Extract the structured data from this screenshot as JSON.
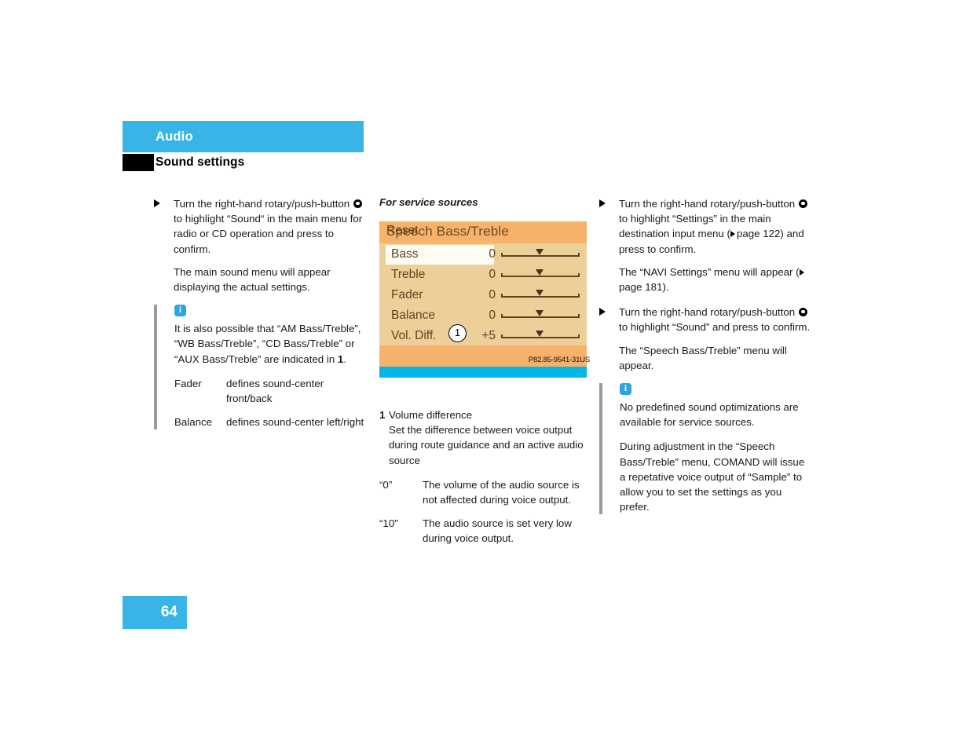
{
  "header": {
    "chapter": "Audio",
    "section": "Sound settings",
    "accent_color": "#38b5e6",
    "marker_color": "#000000"
  },
  "column_1": {
    "step_1": {
      "line_a": "Turn the right-hand rotary/push-button",
      "line_b": "to highlight “Sound“ in the main menu for radio or CD operation and press to confirm.",
      "result": "The main sound menu will appear displaying the actual settings."
    },
    "note": {
      "icon": "info-icon",
      "text_parts": {
        "before": "It is also possible that “AM Bass/Treble”, “WB Bass/Treble”, “CD Bass/Treble” or “AUX Bass/Treble” are indicated in ",
        "callout": "1",
        "after": "."
      },
      "definitions": [
        {
          "term": "Fader",
          "desc": "defines sound-center front/back"
        },
        {
          "term": "Balance",
          "desc": "defines sound-center left/right"
        }
      ]
    }
  },
  "column_2": {
    "figure_heading": "For service sources",
    "comand_screen": {
      "title": "Speech Bass/Treble",
      "rows": [
        {
          "label": "Bass",
          "value": "0",
          "highlighted": true
        },
        {
          "label": "Treble",
          "value": "0",
          "highlighted": false
        },
        {
          "label": "Fader",
          "value": "0",
          "highlighted": false
        },
        {
          "label": "Balance",
          "value": "0",
          "highlighted": false
        },
        {
          "label": "Vol. Diff.",
          "value": "+5",
          "highlighted": false
        }
      ],
      "reset_label": "Reset",
      "callout_label": "1",
      "colors": {
        "title_bar": "#f6b26b",
        "body": "#edcf9a",
        "highlight": "#fdfbf4",
        "text": "#5f4420",
        "bottom_bar": "#00b7e8"
      }
    },
    "figure_code": "P82.85-9541-31US",
    "caption": {
      "number": "1",
      "title": "Volume difference",
      "description": "Set the difference between voice output during route guidance and an active audio source",
      "values": [
        {
          "term": "“0”",
          "desc": "The volume of the audio source is not affected during voice output."
        },
        {
          "term": "“10”",
          "desc": "The audio source is set very low during voice output."
        }
      ]
    }
  },
  "column_3": {
    "step_1": {
      "line_a": "Turn the right-hand rotary/push-button",
      "line_b_pre": "to highlight “Settings” in the main destination input menu (",
      "page_ref_1": "page 122",
      "line_b_post": ") and press to confirm.",
      "result_pre": "The “NAVI Settings” menu will appear (",
      "page_ref_2": "page 181",
      "result_post": ")."
    },
    "step_2": {
      "line_a": "Turn the right-hand rotary/push-button",
      "line_b": "to highlight “Sound” and press to confirm.",
      "result": "The “Speech Bass/Treble” menu will appear."
    },
    "note": {
      "icon": "info-icon",
      "paragraph_1": "No predefined sound optimizations are available for service sources.",
      "paragraph_2": "During adjustment in the “Speech Bass/Treble” menu, COMAND will issue a repetative voice output of “Sample” to allow you to set the settings as you prefer."
    }
  },
  "footer": {
    "page_number": "64"
  }
}
